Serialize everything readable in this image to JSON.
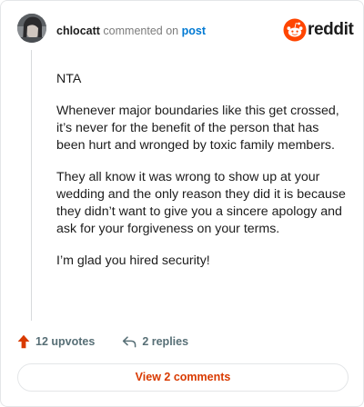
{
  "comment": {
    "username": "chlocatt",
    "action_text": "commented on",
    "post_link": "post",
    "paragraphs": [
      "NTA",
      "Whenever major boundaries like this get crossed, it’s never for the benefit of the person that has been hurt and wronged by toxic family members.",
      "They all know it was wrong to show up at your wedding and the only reason they did it is because they didn’t want to give you a sincere apology and ask for your forgiveness on your terms.",
      "I’m glad you hired security!"
    ]
  },
  "brand": {
    "name": "reddit",
    "color": "#ff4500"
  },
  "footer": {
    "upvotes": "12 upvotes",
    "replies": "2 replies",
    "upvote_icon": "upvote-arrow-icon",
    "reply_icon": "reply-arrow-icon"
  },
  "view_button": {
    "label": "View 2 comments",
    "color": "#d93a00"
  }
}
